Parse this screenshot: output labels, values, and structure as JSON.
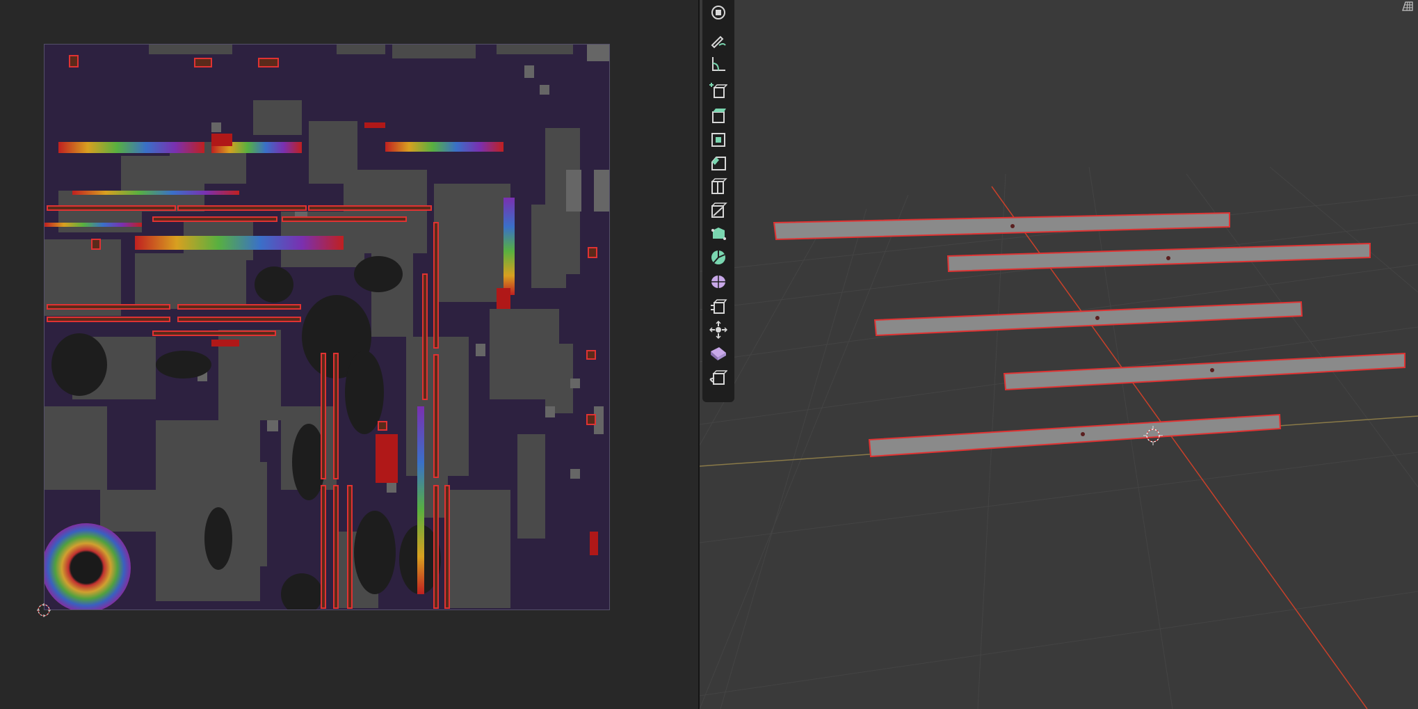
{
  "colors": {
    "background": "#282828",
    "uv_canvas": "#2d2140",
    "viewport_bg": "#3a3a3a",
    "toolbar_bg": "#1e1e1e",
    "selection": "#e03232",
    "mesh_face": "#8a8a8a",
    "tool_icon": "#d8d8d8",
    "tool_icon_accent": "#7ad6b0",
    "x_axis": "#c8402a",
    "y_axis": "#9a8a4a"
  },
  "uv_editor": {
    "canvas_icon": "uv-texture-preview",
    "cursor_icon": "uv-2d-cursor-icon"
  },
  "toolbar": {
    "tools": [
      {
        "name": "view-selection-icon"
      },
      {
        "name": "annotate-tool-icon"
      },
      {
        "name": "measure-tool-icon"
      },
      {
        "name": "add-cube-tool-icon"
      },
      {
        "name": "extrude-region-tool-icon"
      },
      {
        "name": "inset-faces-tool-icon"
      },
      {
        "name": "bevel-tool-icon"
      },
      {
        "name": "loop-cut-tool-icon"
      },
      {
        "name": "knife-tool-icon"
      },
      {
        "name": "poly-build-tool-icon"
      },
      {
        "name": "spin-tool-icon"
      },
      {
        "name": "smooth-tool-icon"
      },
      {
        "name": "edge-slide-tool-icon"
      },
      {
        "name": "shrink-fatten-tool-icon"
      },
      {
        "name": "shear-tool-icon"
      },
      {
        "name": "rip-region-tool-icon"
      }
    ]
  },
  "viewport": {
    "gizmo_icon": "grid-view-icon",
    "cursor_icon": "3d-cursor-icon",
    "selected_objects": 5
  }
}
